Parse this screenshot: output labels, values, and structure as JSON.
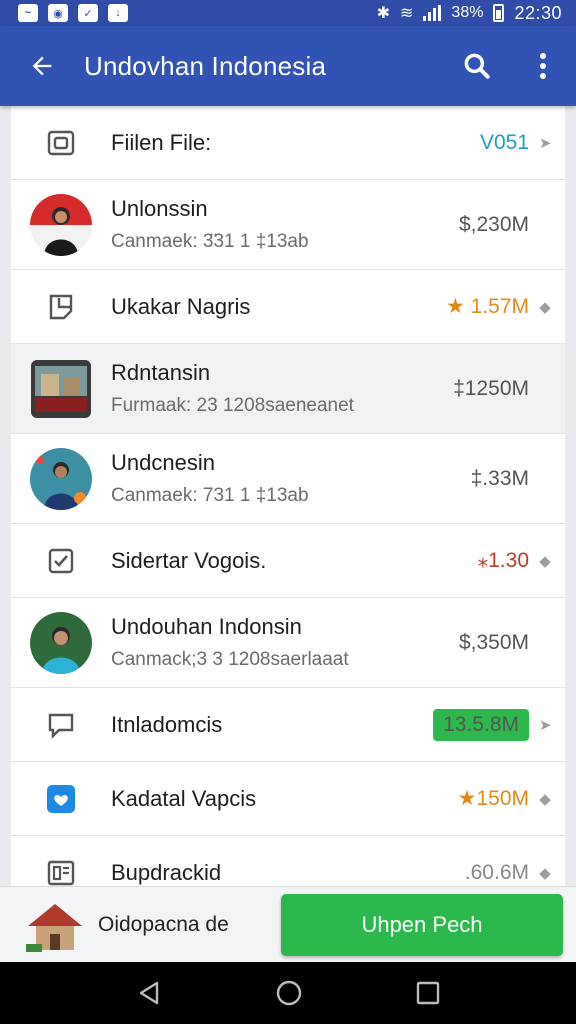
{
  "status_bar": {
    "battery": "38%",
    "time": "22:30",
    "icons": [
      "notification-icon",
      "sync-icon",
      "mail-icon",
      "download-icon"
    ]
  },
  "app_bar": {
    "title": "Undovhan Indonesia",
    "back_icon": "arrow-left-icon",
    "search_icon": "search-icon",
    "menu_icon": "more-vert-icon"
  },
  "list": {
    "header": {
      "label": "Fiilen File:",
      "value": "V051"
    },
    "items": [
      {
        "title": "Unlonssin",
        "subtitle": "Canmaek: 3̈31 1 ‡13ab",
        "value": "$,230M"
      },
      {
        "title": "Ukakar Nagris",
        "value": "★ 1.57M"
      },
      {
        "title": "Rdntansin",
        "subtitle": "Furmaak: 23 1208saeneanet",
        "value": "‡1250M"
      },
      {
        "title": "Undcnesin",
        "subtitle": "Canmaek: 731 1 ‡13ab",
        "value": "‡.33M"
      },
      {
        "title": "Sidertar Vogois.",
        "value": "⁎1.30"
      },
      {
        "title": "Undouhan Indonsin",
        "subtitle": "Canmack;3 3 1208saerlaaat",
        "value": "$,350M"
      },
      {
        "title": "Itnladomcis",
        "value": "13.5.8M"
      },
      {
        "title": "Kadatal Vapcis",
        "value": "★150M"
      },
      {
        "title": "Bupdrackid",
        "value": ".60.6M"
      }
    ]
  },
  "bottom_bar": {
    "label": "Oidopacna de",
    "button": "Uhpen Pech"
  },
  "colors": {
    "primary": "#3153b3",
    "accent_green": "#2db84d",
    "teal": "#1fa6a6",
    "star_orange": "#f0a020",
    "red": "#c0392b"
  }
}
